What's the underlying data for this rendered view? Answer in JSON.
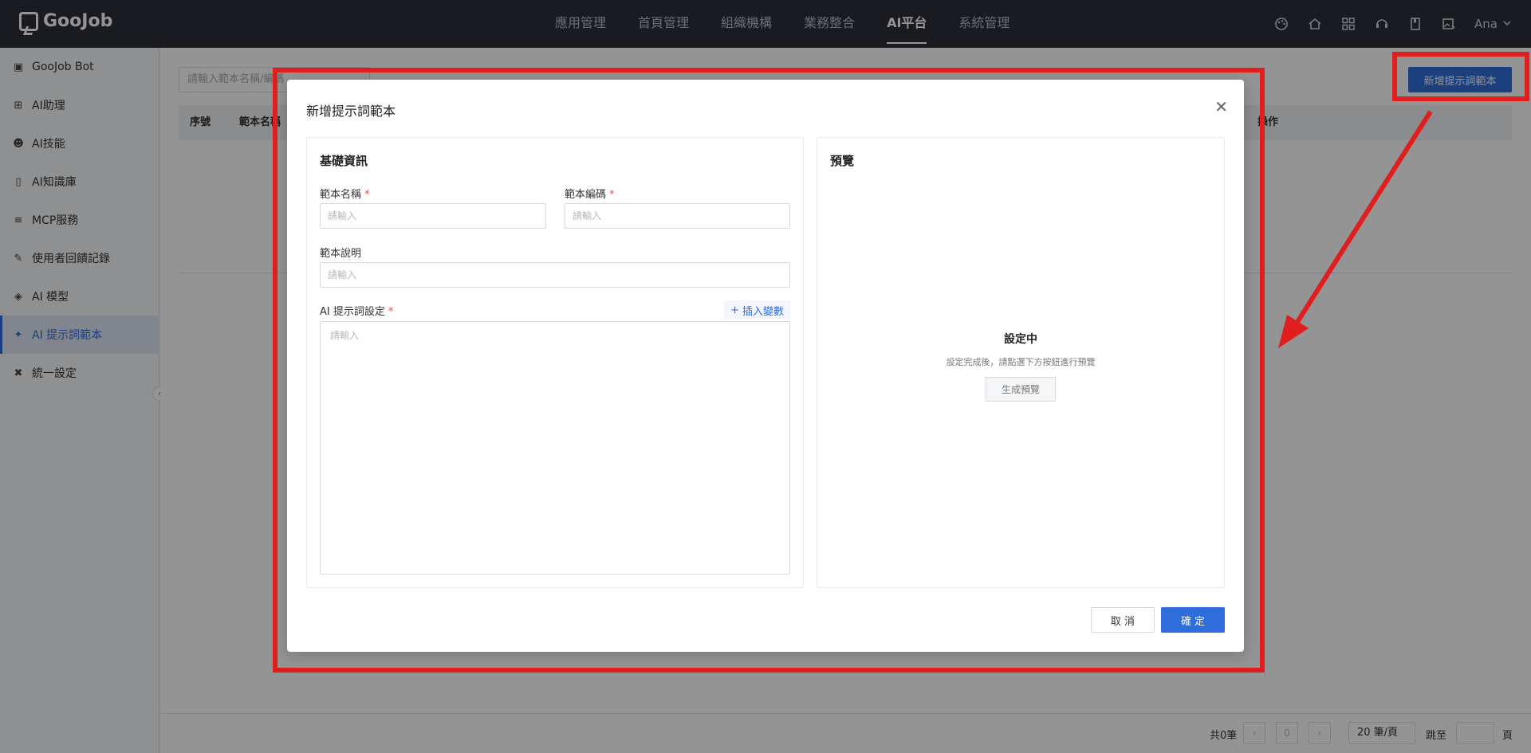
{
  "app": {
    "logo_text": "GooJob"
  },
  "nav": {
    "items": [
      {
        "label": "應用管理"
      },
      {
        "label": "首頁管理"
      },
      {
        "label": "組織機構"
      },
      {
        "label": "業務整合"
      },
      {
        "label": "AI平台"
      },
      {
        "label": "系統管理"
      }
    ],
    "active": "AI平台"
  },
  "user": {
    "name": "Ana"
  },
  "sidebar": {
    "items": [
      {
        "label": "GooJob Bot",
        "icon": "robot-icon"
      },
      {
        "label": "AI助理",
        "icon": "grid-icon"
      },
      {
        "label": "AI技能",
        "icon": "skill-icon"
      },
      {
        "label": "AI知識庫",
        "icon": "book-icon"
      },
      {
        "label": "MCP服務",
        "icon": "layers-icon"
      },
      {
        "label": "使用者回饋記錄",
        "icon": "edit-doc-icon"
      },
      {
        "label": "AI 模型",
        "icon": "cube-icon"
      },
      {
        "label": "AI 提示詞範本",
        "icon": "magic-icon"
      },
      {
        "label": "統一設定",
        "icon": "tools-icon"
      }
    ],
    "active": "AI 提示詞範本"
  },
  "main": {
    "search_placeholder": "請輸入範本名稱/編碼",
    "add_button": "新增提示詞範本",
    "columns": [
      "序號",
      "範本名稱",
      "操作"
    ]
  },
  "pager": {
    "total": "共0筆",
    "page": "0",
    "page_size": "20 筆/頁",
    "jump_label": "跳至",
    "page_unit": "頁"
  },
  "modal": {
    "title": "新增提示詞範本",
    "basic_section": "基礎資訊",
    "name_label": "範本名稱",
    "code_label": "範本編碼",
    "desc_label": "範本說明",
    "prompt_label": "AI 提示詞設定",
    "placeholder": "請輸入",
    "insert_var": "插入變數",
    "preview_section": "預覽",
    "preview_status": "設定中",
    "preview_hint": "設定完成後，請點選下方按鈕進行預覽",
    "generate_btn": "生成預覽",
    "cancel_btn": "取 消",
    "ok_btn": "確 定"
  },
  "colors": {
    "accent": "#2f6ddb",
    "annotation": "#e01e1e",
    "topbar": "#2b2f38"
  }
}
